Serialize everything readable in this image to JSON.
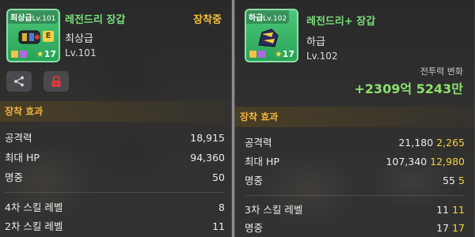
{
  "left": {
    "item": {
      "grade_tag": "최상급",
      "grade_tag_lv": "Lv.101",
      "stars": "17",
      "name": "레전드리 장갑",
      "grade": "최상급",
      "level": "Lv.101",
      "status": "장착중"
    },
    "section_title": "장착 효과",
    "stats": [
      {
        "label": "공격력",
        "value": "18,915"
      },
      {
        "label": "최대 HP",
        "value": "94,360"
      },
      {
        "label": "명중",
        "value": "50"
      }
    ],
    "skills": [
      {
        "label": "4차 스킬 레벨",
        "value": "8"
      },
      {
        "label": "2차 스킬 레벨",
        "value": "11"
      }
    ]
  },
  "right": {
    "item": {
      "grade_tag": "하급",
      "grade_tag_lv": "Lv.102",
      "stars": "17",
      "name": "레전드리+ 장갑",
      "grade": "하급",
      "level": "Lv.102"
    },
    "power_label": "전투력 변화",
    "power_value": "+2309억 5243만",
    "section_title": "장착 효과",
    "stats": [
      {
        "label": "공격력",
        "base": "21,180",
        "bonus": "2,265"
      },
      {
        "label": "최대 HP",
        "base": "107,340",
        "bonus": "12,980"
      },
      {
        "label": "명중",
        "base": "55",
        "bonus": "5"
      }
    ],
    "skills": [
      {
        "label": "3차 스킬 레벨",
        "base": "11",
        "bonus": "11"
      },
      {
        "label": "명중",
        "base": "17",
        "bonus": "17"
      }
    ]
  },
  "icons": {
    "share": "share-icon",
    "lock": "lock-icon"
  },
  "colors": {
    "item_name": "#78e07e",
    "equipped": "#f6c13b",
    "section_title": "#f2b63e",
    "bonus": "#f2d43a",
    "power_gain": "#8be06e",
    "lock_red": "#e0383c"
  }
}
